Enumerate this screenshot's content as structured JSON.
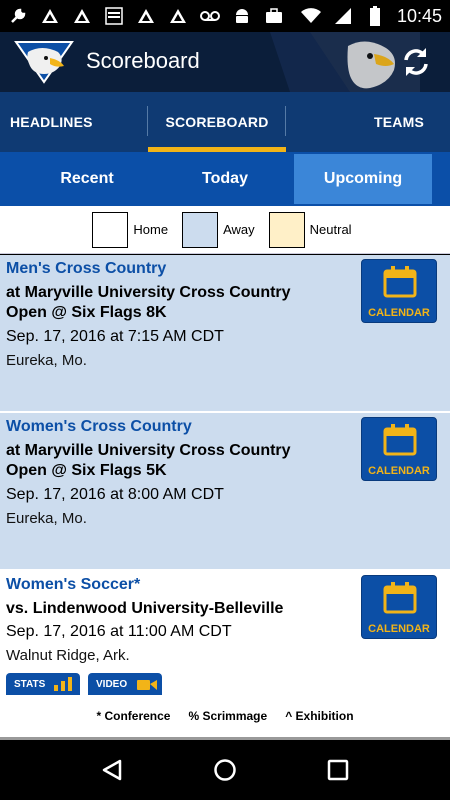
{
  "status_bar": {
    "time": "10:45",
    "left_icons": [
      "wrench-icon",
      "triangle-icon",
      "triangle-icon",
      "calendar-app-icon",
      "triangle-icon",
      "triangle-icon",
      "voicemail-icon",
      "android-icon",
      "briefcase-icon"
    ],
    "right_icons": [
      "wifi-icon",
      "signal-icon",
      "battery-icon"
    ]
  },
  "app_bar": {
    "title": "Scoreboard"
  },
  "top_tabs": [
    {
      "label": "HEADLINES",
      "active": false
    },
    {
      "label": "SCOREBOARD",
      "active": true
    },
    {
      "label": "TEAMS",
      "active": false
    }
  ],
  "sub_tabs": [
    {
      "label": "Recent",
      "active": false
    },
    {
      "label": "Today",
      "active": false
    },
    {
      "label": "Upcoming",
      "active": true
    }
  ],
  "legend": [
    {
      "label": "Home",
      "color": "#ffffff"
    },
    {
      "label": "Away",
      "color": "#ccdcee"
    },
    {
      "label": "Neutral",
      "color": "#fff0c8"
    }
  ],
  "events": [
    {
      "sport": "Men's Cross Country",
      "opponent_line1": "at Maryville University Cross Country",
      "opponent_line2": "Open @ Six Flags 8K",
      "datetime": "Sep. 17, 2016 at 7:15 AM CDT",
      "location": "Eureka, Mo.",
      "calendar_label": "CALENDAR",
      "type": "away"
    },
    {
      "sport": "Women's Cross Country",
      "opponent_line1": "at Maryville University Cross Country",
      "opponent_line2": "Open @ Six Flags 5K",
      "datetime": "Sep. 17, 2016 at 8:00 AM CDT",
      "location": "Eureka, Mo.",
      "calendar_label": "CALENDAR",
      "type": "away"
    },
    {
      "sport": "Women's Soccer*",
      "opponent_line1": "vs. Lindenwood University-Belleville",
      "datetime": "Sep. 17, 2016 at 11:00 AM CDT",
      "location": "Walnut Ridge, Ark.",
      "calendar_label": "CALENDAR",
      "type": "home",
      "buttons": [
        "STATS",
        "VIDEO"
      ]
    }
  ],
  "footer": {
    "conference": "* Conference",
    "scrimmage": "% Scrimmage",
    "exhibition": "^ Exhibition"
  },
  "colors": {
    "primary_blue": "#0c4fa6",
    "accent_gold": "#f2b418",
    "away_bg": "#ccdcee",
    "neutral_bg": "#fff0c8"
  }
}
